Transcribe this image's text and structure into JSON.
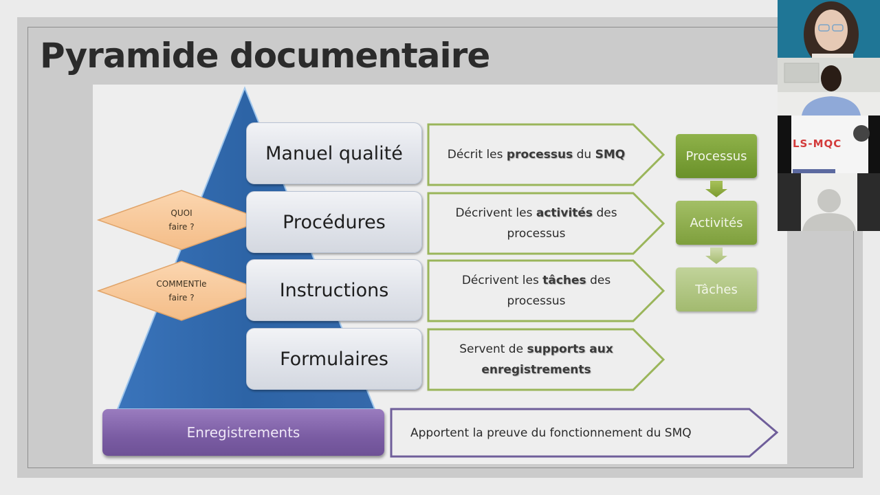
{
  "slide": {
    "title": "Pyramide documentaire"
  },
  "pyramid": {
    "levels": [
      {
        "label": "Manuel qualité",
        "desc_parts": [
          "Décrit les ",
          "processus",
          " du ",
          "SMQ"
        ],
        "desc_bold": [
          false,
          true,
          false,
          true
        ]
      },
      {
        "label": "Procédures",
        "desc_line1": [
          "Décrivent les ",
          "activités",
          " des"
        ],
        "desc_line2": "processus"
      },
      {
        "label": "Instructions",
        "desc_line1": [
          "Décrivent les ",
          "tâches",
          " des"
        ],
        "desc_line2": "processus"
      },
      {
        "label": "Formulaires",
        "desc_line1": [
          "Servent de ",
          "supports aux"
        ],
        "desc_line2": "enregistrements"
      }
    ],
    "base": {
      "label": "Enregistrements",
      "desc": "Apportent la preuve du fonctionnement  du SMQ"
    },
    "diamonds": [
      {
        "line1": "QUOI",
        "line2": "faire ?"
      },
      {
        "line1": "COMMENTle",
        "line2": "faire ?"
      }
    ],
    "flow": [
      "Processus",
      "Activités",
      "Tâches"
    ]
  },
  "colors": {
    "pyramid_blue": "#2d64a6",
    "level_border_green": "#9ab55a",
    "flow_green_dark": "#6f9a2e",
    "flow_green_mid": "#86ab45",
    "flow_green_light": "#a9c37c",
    "diamond_orange": "#f8c99c",
    "records_purple": "#7a5ca3",
    "records_border": "#6f5e9a"
  },
  "participants": [
    {
      "name": "participant-1",
      "type": "video"
    },
    {
      "name": "participant-2",
      "type": "video"
    },
    {
      "name": "participant-3",
      "type": "logo",
      "logo_text": "LS-MQC"
    },
    {
      "name": "participant-4",
      "type": "avatar"
    }
  ]
}
